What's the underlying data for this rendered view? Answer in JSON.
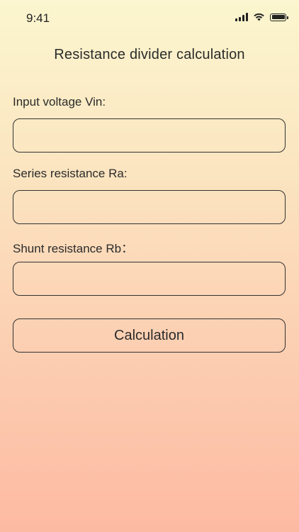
{
  "status_bar": {
    "time": "9:41",
    "icons": [
      "signal-icon",
      "wifi-icon",
      "battery-icon"
    ]
  },
  "title": "Resistance divider calculation",
  "fields": [
    {
      "label": "Input voltage Vin:",
      "value": "",
      "placeholder": ""
    },
    {
      "label": "Series resistance Ra:",
      "value": "",
      "placeholder": ""
    },
    {
      "label": "Shunt resistance Rb：",
      "value": "",
      "placeholder": ""
    }
  ],
  "button": {
    "label": "Calculation"
  },
  "colors": {
    "gradient_top": "#fbf6cf",
    "gradient_bottom": "#fdbaa2",
    "text": "#2b2b2b",
    "border": "#333333"
  }
}
